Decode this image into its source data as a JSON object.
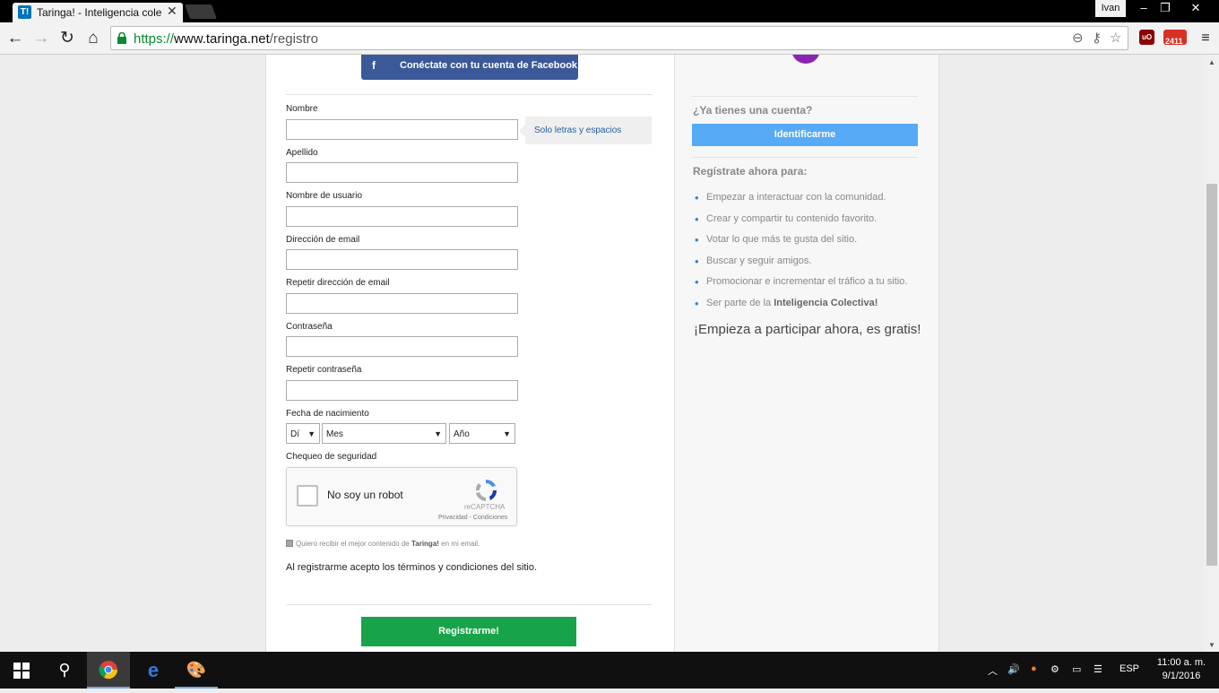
{
  "browser": {
    "tab_favicon": "T!",
    "tab_title": "Taringa! - Inteligencia cole",
    "profile_name": "Ivan",
    "url_scheme": "https://",
    "url_domain": "www.taringa.net",
    "url_path": "/registro",
    "extension_badge": "2411"
  },
  "form": {
    "facebook_button": "Conéctate con tu cuenta de Facebook",
    "fields": [
      {
        "label": "Nombre"
      },
      {
        "label": "Apellido"
      },
      {
        "label": "Nombre de usuario"
      },
      {
        "label": "Dirección de email"
      },
      {
        "label": "Repetir dirección de email"
      },
      {
        "label": "Contraseña"
      },
      {
        "label": "Repetir contraseña"
      }
    ],
    "name_hint": "Solo letras y espacios",
    "birthdate_label": "Fecha de nacimiento",
    "day_select": "Dí",
    "month_select": "Mes",
    "year_select": "Año",
    "security_label": "Chequeo de seguridad",
    "captcha_label": "No soy un robot",
    "captcha_brand": "reCAPTCHA",
    "captcha_links": "Privacidad - Condiciones",
    "newsletter_pre": "Quiero recibir el mejor contenido de",
    "newsletter_brand": "Taringa!",
    "newsletter_post": "en mi email.",
    "terms_text": "Al registrarme acepto los términos y condiciones del sitio.",
    "submit_button": "Registrarme!"
  },
  "sidebar": {
    "have_account": "¿Ya tienes una cuenta?",
    "login_button": "Identificarme",
    "register_now": "Regístrate ahora para:",
    "benefits": [
      "Empezar a interactuar con la comunidad.",
      "Crear y compartir tu contenido favorito.",
      "Votar lo que más te gusta del sitio.",
      "Buscar y seguir amigos.",
      "Promocionar e incrementar el tráfico a tu sitio."
    ],
    "last_benefit_pre": "Ser parte de la",
    "last_benefit_bold": "Inteligencia Colectiva!",
    "cta": "¡Empieza a participar ahora, es gratis!"
  },
  "taskbar": {
    "language": "ESP",
    "time": "11:00 a. m.",
    "date": "9/1/2016"
  },
  "colors": {
    "facebook": "#3b5998",
    "login_blue": "#57aaf5",
    "register_green": "#17a349"
  }
}
